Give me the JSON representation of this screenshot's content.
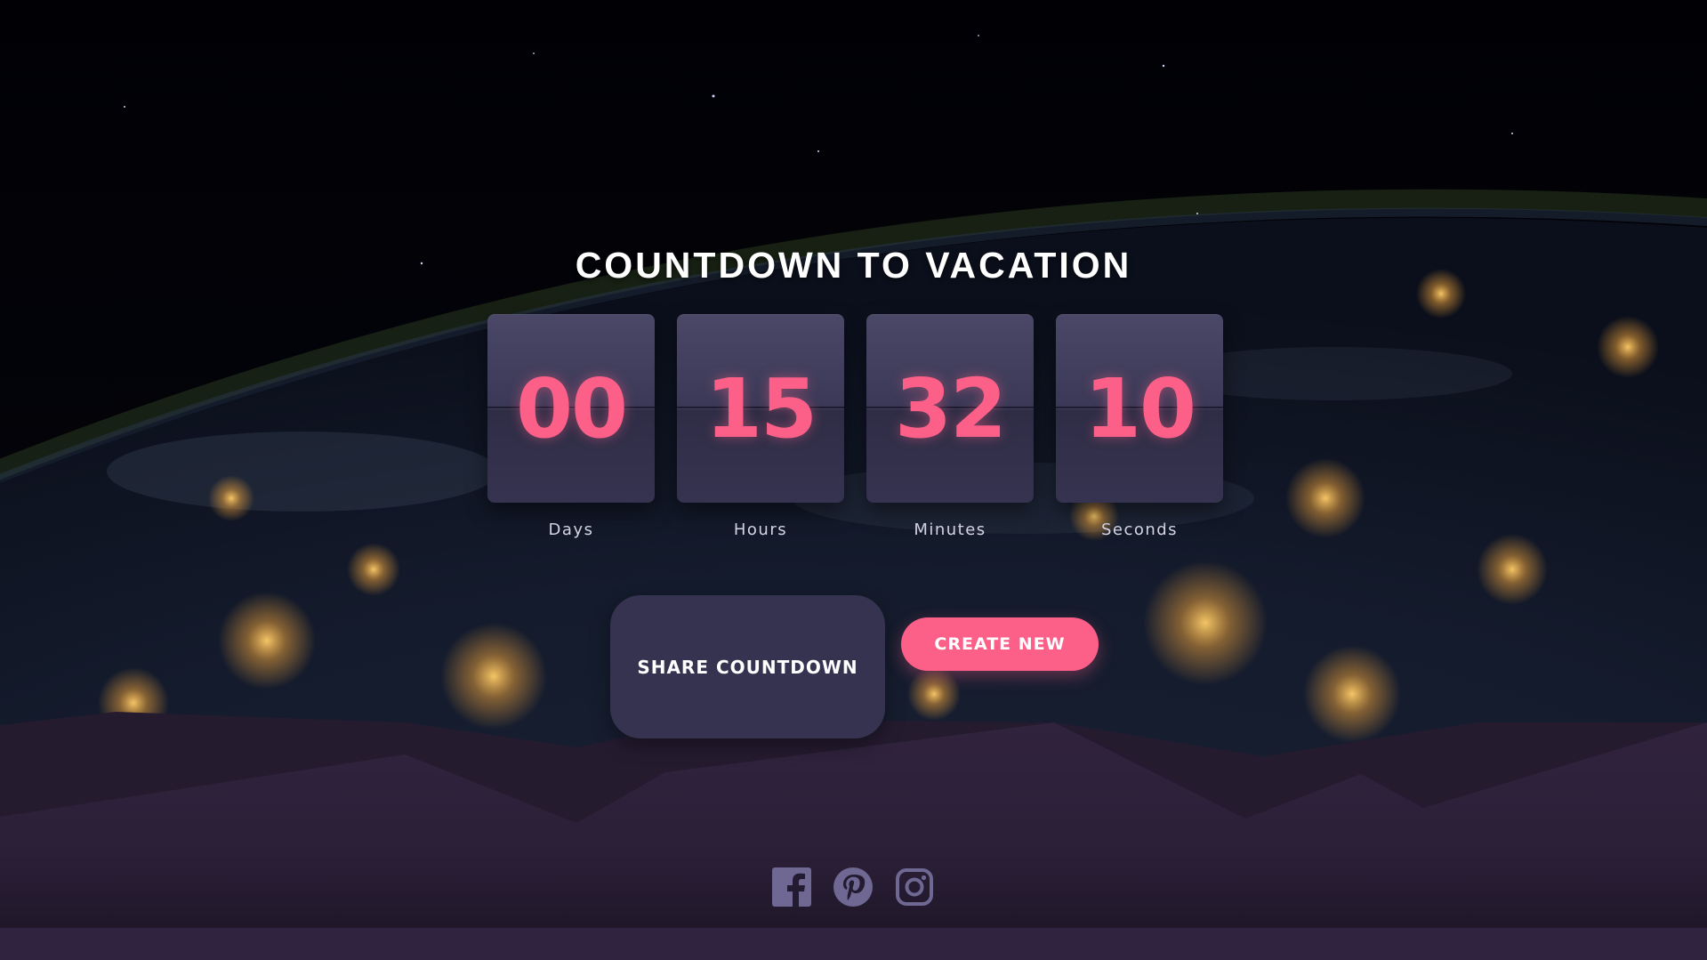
{
  "page": {
    "title": "COUNTDOWN TO VACATION"
  },
  "countdown": {
    "units": [
      {
        "value": "00",
        "label": "Days"
      },
      {
        "value": "15",
        "label": "Hours"
      },
      {
        "value": "32",
        "label": "Minutes"
      },
      {
        "value": "10",
        "label": "Seconds"
      }
    ]
  },
  "actions": {
    "share_label": "SHARE COUNTDOWN",
    "create_label": "CREATE NEW"
  },
  "social": {
    "icons": [
      "facebook-icon",
      "pinterest-icon",
      "instagram-icon"
    ]
  },
  "colors": {
    "accent": "#fc5f88",
    "card": "#3b3957",
    "mountain": "#31233e",
    "icon": "#6e6893"
  }
}
